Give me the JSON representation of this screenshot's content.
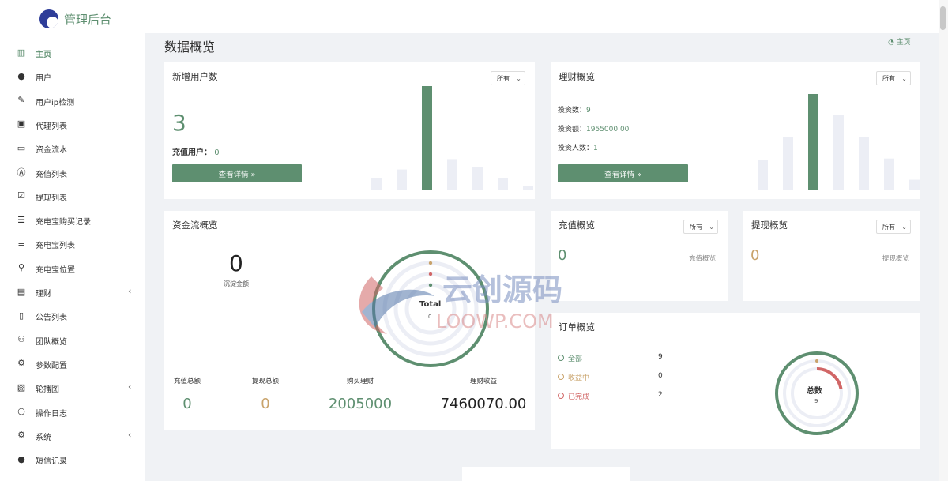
{
  "app": {
    "brand": "管理后台"
  },
  "sidebar": {
    "items": [
      {
        "label": "主页",
        "icon": "bar-chart-icon",
        "glyph": "▥",
        "active": true,
        "has_arrow": false
      },
      {
        "label": "用户",
        "icon": "user-icon",
        "glyph": "●",
        "active": false,
        "has_arrow": false
      },
      {
        "label": "用户ip检测",
        "icon": "pen-icon",
        "glyph": "✎",
        "active": false,
        "has_arrow": false
      },
      {
        "label": "代理列表",
        "icon": "address-book-icon",
        "glyph": "▣",
        "active": false,
        "has_arrow": false
      },
      {
        "label": "资金流水",
        "icon": "money-icon",
        "glyph": "▭",
        "active": false,
        "has_arrow": false
      },
      {
        "label": "充值列表",
        "icon": "a-square-icon",
        "glyph": "Ⓐ",
        "active": false,
        "has_arrow": false
      },
      {
        "label": "提现列表",
        "icon": "check-square-icon",
        "glyph": "☑",
        "active": false,
        "has_arrow": false
      },
      {
        "label": "充电宝购买记录",
        "icon": "list-icon",
        "glyph": "☰",
        "active": false,
        "has_arrow": false
      },
      {
        "label": "充电宝列表",
        "icon": "indent-list-icon",
        "glyph": "≡",
        "active": false,
        "has_arrow": false
      },
      {
        "label": "充电宝位置",
        "icon": "map-pin-icon",
        "glyph": "⚲",
        "active": false,
        "has_arrow": false
      },
      {
        "label": "理财",
        "icon": "archive-icon",
        "glyph": "▤",
        "active": false,
        "has_arrow": true
      },
      {
        "label": "公告列表",
        "icon": "file-icon",
        "glyph": "▯",
        "active": false,
        "has_arrow": false
      },
      {
        "label": "团队概览",
        "icon": "users-icon",
        "glyph": "⚇",
        "active": false,
        "has_arrow": false
      },
      {
        "label": "参数配置",
        "icon": "cogs-icon",
        "glyph": "⚙",
        "active": false,
        "has_arrow": false
      },
      {
        "label": "轮播图",
        "icon": "image-icon",
        "glyph": "▧",
        "active": false,
        "has_arrow": true
      },
      {
        "label": "操作日志",
        "icon": "circle-icon",
        "glyph": "○",
        "active": false,
        "has_arrow": false
      },
      {
        "label": "系统",
        "icon": "gear-icon",
        "glyph": "⚙",
        "active": false,
        "has_arrow": true
      },
      {
        "label": "短信记录",
        "icon": "comment-icon",
        "glyph": "●",
        "active": false,
        "has_arrow": false
      }
    ],
    "arrow_glyph": "‹"
  },
  "header": {
    "title": "数据概览",
    "breadcrumb": "主页",
    "breadcrumb_icon": "dashboard-icon"
  },
  "new_users": {
    "title": "新增用户数",
    "filter": "所有",
    "count": "3",
    "recharge_label": "充值用户：",
    "recharge_value": "0",
    "button": "查看详情 »",
    "bars": [
      0.12,
      0.2,
      1.0,
      0.3,
      0.22,
      0.12,
      0.04
    ],
    "highlight_index": 2
  },
  "finance": {
    "title": "理财概览",
    "filter": "所有",
    "rows": [
      {
        "label": "投资数：",
        "value": "9"
      },
      {
        "label": "投资额：",
        "value": "1955000.00"
      },
      {
        "label": "投资人数：",
        "value": "1"
      }
    ],
    "button": "查看详情 »",
    "bars": [
      0.32,
      0.55,
      1.0,
      0.78,
      0.55,
      0.33,
      0.11
    ],
    "highlight_index": 2
  },
  "fund_flow": {
    "title": "资金流概览",
    "balance_value": "0",
    "balance_label": "沉淀金额",
    "ring_title": "Total",
    "ring_value": "0",
    "stats": [
      {
        "label": "充值总额",
        "value": "0",
        "color": "green"
      },
      {
        "label": "提现总额",
        "value": "0",
        "color": "amber"
      },
      {
        "label": "购买理财",
        "value": "2005000",
        "color": "green"
      },
      {
        "label": "理财收益",
        "value": "7460070.00",
        "color": "dark"
      }
    ]
  },
  "recharge": {
    "title": "充值概览",
    "filter": "所有",
    "value": "0",
    "caption": "充值概览"
  },
  "withdraw": {
    "title": "提现概览",
    "filter": "所有",
    "value": "0",
    "caption": "提现概览"
  },
  "orders": {
    "title": "订单概览",
    "items": [
      {
        "label": "全部",
        "value": "9",
        "color": "green"
      },
      {
        "label": "收益中",
        "value": "0",
        "color": "amber"
      },
      {
        "label": "已完成",
        "value": "2",
        "color": "red"
      }
    ],
    "ring_title": "总数",
    "ring_value": "9",
    "completed_fraction": 0.222
  },
  "watermark": {
    "line1": "云创源码",
    "line2": "LOOWP.COM"
  },
  "colors": {
    "green": "#5e8f70",
    "amber": "#c9a36b",
    "red": "#d16666",
    "bar_idle": "#eceef5"
  }
}
